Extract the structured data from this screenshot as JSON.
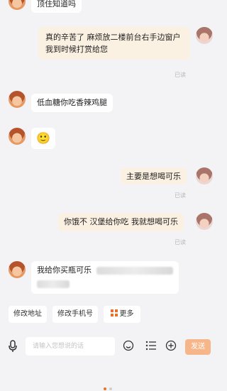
{
  "messages": [
    {
      "side": "left",
      "text": "顶住知道吗",
      "read": ""
    },
    {
      "side": "right",
      "text": "真的辛苦了 麻烦放二楼前台右手边窗户 我到时候打赏给您",
      "read": "已读"
    },
    {
      "side": "left",
      "text": "低血糖你吃香辣鸡腿",
      "read": ""
    },
    {
      "side": "left",
      "text": "🙂",
      "read": ""
    },
    {
      "side": "right",
      "text": "主要是想喝可乐",
      "read": "已读"
    },
    {
      "side": "right",
      "text": "你饿不 汉堡给你吃 我就想喝可乐",
      "read": "已读"
    },
    {
      "side": "left",
      "text": "我给你买瓶可乐",
      "read": ""
    }
  ],
  "quick_replies": [
    "修改地址",
    "修改手机号",
    "更多"
  ],
  "input": {
    "placeholder": "请输入您想说的话"
  },
  "send_button": "发送",
  "colors": {
    "accent": "#e8702f",
    "send": "#f7b58a",
    "right_bubble": "#fbf1e2"
  }
}
